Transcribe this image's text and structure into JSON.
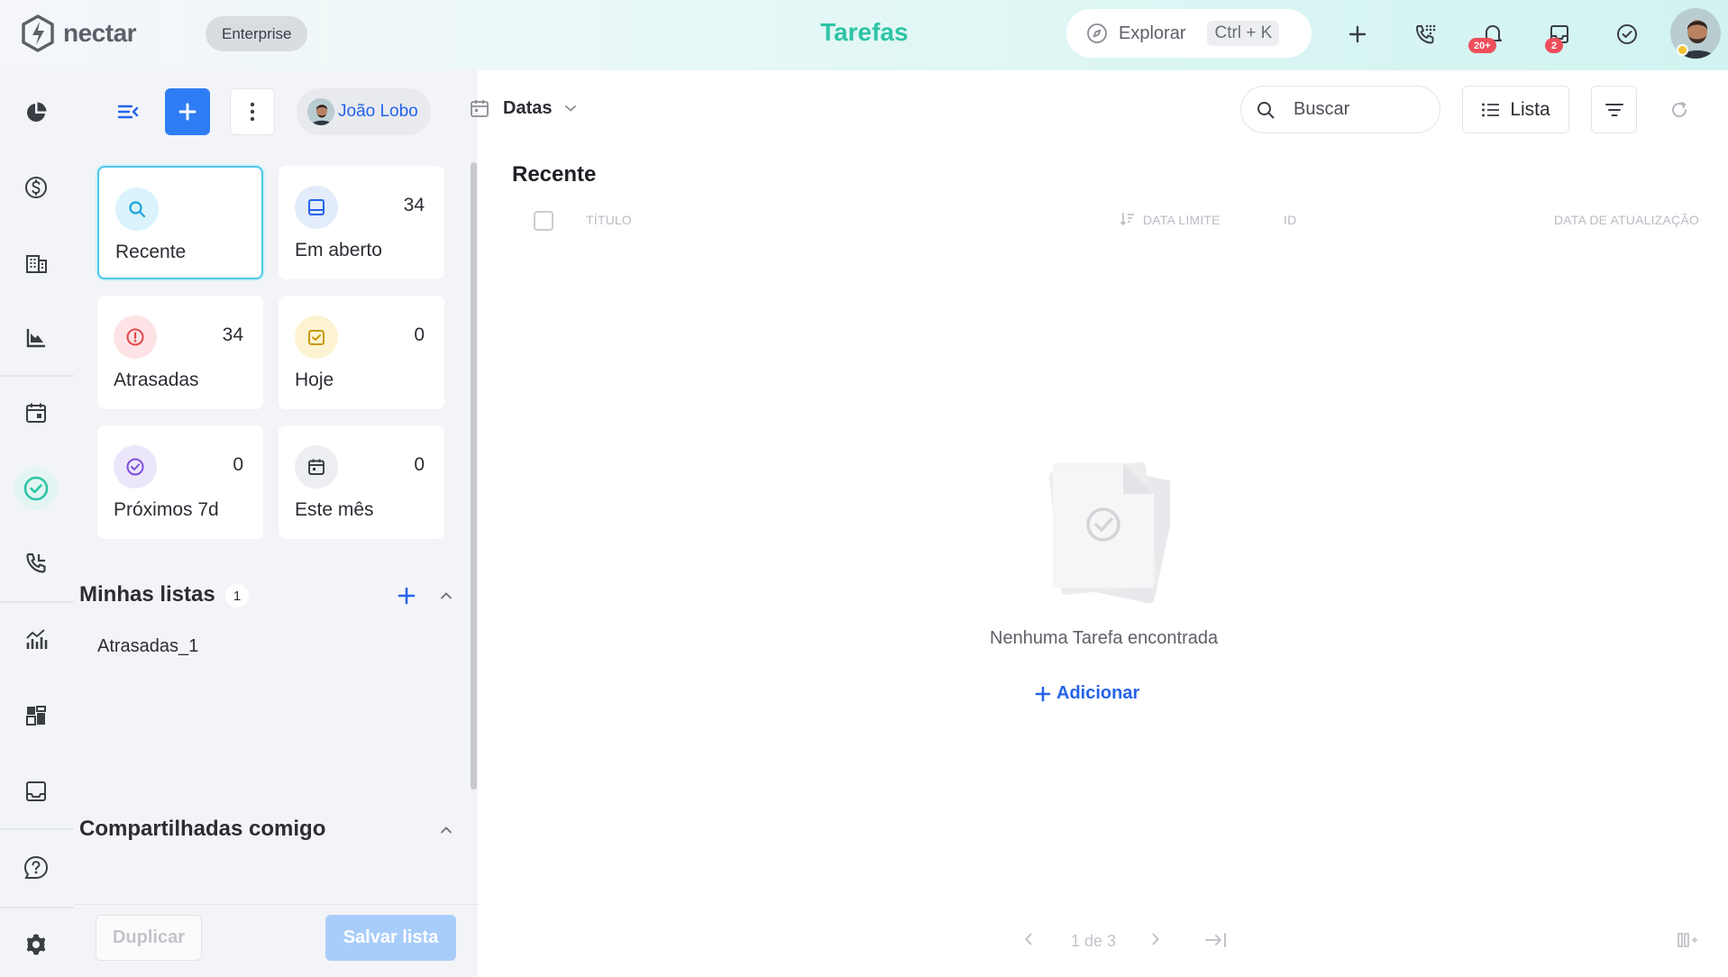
{
  "brand": {
    "name": "nectar",
    "plan": "Enterprise"
  },
  "header": {
    "title": "Tarefas",
    "explore_label": "Explorar",
    "explore_shortcut": "Ctrl + K",
    "notifications_badge": "20+",
    "inbox_badge": "2"
  },
  "toolbar": {
    "owner_name": "João Lobo",
    "dates_label": "Datas"
  },
  "cards": [
    {
      "label": "Recente",
      "count": ""
    },
    {
      "label": "Em aberto",
      "count": "34"
    },
    {
      "label": "Atrasadas",
      "count": "34"
    },
    {
      "label": "Hoje",
      "count": "0"
    },
    {
      "label": "Próximos 7d",
      "count": "0"
    },
    {
      "label": "Este mês",
      "count": "0"
    }
  ],
  "my_lists": {
    "title": "Minhas listas",
    "count": "1",
    "items": [
      "Atrasadas_1"
    ]
  },
  "shared": {
    "title": "Compartilhadas comigo"
  },
  "panel_buttons": {
    "duplicate": "Duplicar",
    "save": "Salvar lista"
  },
  "main": {
    "search_placeholder": "Buscar",
    "view_label": "Lista",
    "title": "Recente",
    "columns": [
      "TÍTULO",
      "DATA LIMITE",
      "ID",
      "DATA DE ATUALIZAÇÃO"
    ],
    "empty_text": "Nenhuma Tarefa encontrada",
    "add_label": "Adicionar",
    "pagination": "1 de 3"
  },
  "colors": {
    "accent": "#2563eb",
    "teal": "#2ec4a6",
    "danger": "#ee4e5a"
  },
  "icons": {
    "nav": [
      "pie-chart-icon",
      "dollar-icon",
      "building-icon",
      "funnel-chart-icon",
      "calendar-icon",
      "check-circle-icon",
      "phone-icon",
      "analytics-icon",
      "dashboard-icon",
      "inbox-icon",
      "help-icon",
      "settings-icon"
    ]
  }
}
